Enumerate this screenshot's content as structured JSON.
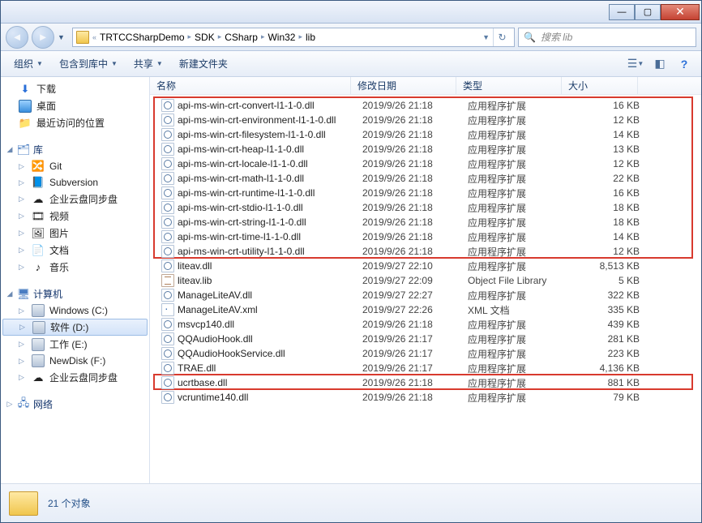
{
  "window": {
    "title": ""
  },
  "nav": {
    "breadcrumb": [
      "TRTCCSharpDemo",
      "SDK",
      "CSharp",
      "Win32",
      "lib"
    ],
    "search_placeholder": "搜索 lib"
  },
  "toolbar": {
    "organize": "组织",
    "include": "包含到库中",
    "share": "共享",
    "newfolder": "新建文件夹"
  },
  "sidebar": {
    "favorites": [
      {
        "icon": "download",
        "label": "下载"
      },
      {
        "icon": "desktop",
        "label": "桌面"
      },
      {
        "icon": "recent",
        "label": "最近访问的位置"
      }
    ],
    "libraries_label": "库",
    "libraries": [
      {
        "icon": "git",
        "label": "Git"
      },
      {
        "icon": "svn",
        "label": "Subversion"
      },
      {
        "icon": "cloud",
        "label": "企业云盘同步盘"
      },
      {
        "icon": "video",
        "label": "视频"
      },
      {
        "icon": "pictures",
        "label": "图片"
      },
      {
        "icon": "documents",
        "label": "文档"
      },
      {
        "icon": "music",
        "label": "音乐"
      }
    ],
    "computer_label": "计算机",
    "computer": [
      {
        "icon": "drive",
        "label": "Windows (C:)"
      },
      {
        "icon": "drive",
        "label": "软件 (D:)",
        "selected": true
      },
      {
        "icon": "drive",
        "label": "工作 (E:)"
      },
      {
        "icon": "drive",
        "label": "NewDisk (F:)"
      },
      {
        "icon": "cloud",
        "label": "企业云盘同步盘"
      }
    ],
    "network_label": "网络"
  },
  "columns": {
    "name": "名称",
    "date": "修改日期",
    "type": "类型",
    "size": "大小"
  },
  "files": [
    {
      "hl": 1,
      "icon": "dll",
      "name": "api-ms-win-crt-convert-l1-1-0.dll",
      "date": "2019/9/26 21:18",
      "type": "应用程序扩展",
      "size": "16 KB"
    },
    {
      "hl": 1,
      "icon": "dll",
      "name": "api-ms-win-crt-environment-l1-1-0.dll",
      "date": "2019/9/26 21:18",
      "type": "应用程序扩展",
      "size": "12 KB"
    },
    {
      "hl": 1,
      "icon": "dll",
      "name": "api-ms-win-crt-filesystem-l1-1-0.dll",
      "date": "2019/9/26 21:18",
      "type": "应用程序扩展",
      "size": "14 KB"
    },
    {
      "hl": 1,
      "icon": "dll",
      "name": "api-ms-win-crt-heap-l1-1-0.dll",
      "date": "2019/9/26 21:18",
      "type": "应用程序扩展",
      "size": "13 KB"
    },
    {
      "hl": 1,
      "icon": "dll",
      "name": "api-ms-win-crt-locale-l1-1-0.dll",
      "date": "2019/9/26 21:18",
      "type": "应用程序扩展",
      "size": "12 KB"
    },
    {
      "hl": 1,
      "icon": "dll",
      "name": "api-ms-win-crt-math-l1-1-0.dll",
      "date": "2019/9/26 21:18",
      "type": "应用程序扩展",
      "size": "22 KB"
    },
    {
      "hl": 1,
      "icon": "dll",
      "name": "api-ms-win-crt-runtime-l1-1-0.dll",
      "date": "2019/9/26 21:18",
      "type": "应用程序扩展",
      "size": "16 KB"
    },
    {
      "hl": 1,
      "icon": "dll",
      "name": "api-ms-win-crt-stdio-l1-1-0.dll",
      "date": "2019/9/26 21:18",
      "type": "应用程序扩展",
      "size": "18 KB"
    },
    {
      "hl": 1,
      "icon": "dll",
      "name": "api-ms-win-crt-string-l1-1-0.dll",
      "date": "2019/9/26 21:18",
      "type": "应用程序扩展",
      "size": "18 KB"
    },
    {
      "hl": 1,
      "icon": "dll",
      "name": "api-ms-win-crt-time-l1-1-0.dll",
      "date": "2019/9/26 21:18",
      "type": "应用程序扩展",
      "size": "14 KB"
    },
    {
      "hl": 1,
      "icon": "dll",
      "name": "api-ms-win-crt-utility-l1-1-0.dll",
      "date": "2019/9/26 21:18",
      "type": "应用程序扩展",
      "size": "12 KB"
    },
    {
      "hl": 0,
      "icon": "dll",
      "name": "liteav.dll",
      "date": "2019/9/27 22:10",
      "type": "应用程序扩展",
      "size": "8,513 KB"
    },
    {
      "hl": 0,
      "icon": "lib",
      "name": "liteav.lib",
      "date": "2019/9/27 22:09",
      "type": "Object File Library",
      "size": "5 KB"
    },
    {
      "hl": 0,
      "icon": "dll",
      "name": "ManageLiteAV.dll",
      "date": "2019/9/27 22:27",
      "type": "应用程序扩展",
      "size": "322 KB"
    },
    {
      "hl": 0,
      "icon": "xml",
      "name": "ManageLiteAV.xml",
      "date": "2019/9/27 22:26",
      "type": "XML 文档",
      "size": "335 KB"
    },
    {
      "hl": 0,
      "icon": "dll",
      "name": "msvcp140.dll",
      "date": "2019/9/26 21:18",
      "type": "应用程序扩展",
      "size": "439 KB"
    },
    {
      "hl": 0,
      "icon": "dll",
      "name": "QQAudioHook.dll",
      "date": "2019/9/26 21:17",
      "type": "应用程序扩展",
      "size": "281 KB"
    },
    {
      "hl": 0,
      "icon": "dll",
      "name": "QQAudioHookService.dll",
      "date": "2019/9/26 21:17",
      "type": "应用程序扩展",
      "size": "223 KB"
    },
    {
      "hl": 0,
      "icon": "dll",
      "name": "TRAE.dll",
      "date": "2019/9/26 21:17",
      "type": "应用程序扩展",
      "size": "4,136 KB"
    },
    {
      "hl": 2,
      "icon": "dll",
      "name": "ucrtbase.dll",
      "date": "2019/9/26 21:18",
      "type": "应用程序扩展",
      "size": "881 KB"
    },
    {
      "hl": 0,
      "icon": "dll",
      "name": "vcruntime140.dll",
      "date": "2019/9/26 21:18",
      "type": "应用程序扩展",
      "size": "79 KB"
    }
  ],
  "status": {
    "count": "21 个对象"
  }
}
